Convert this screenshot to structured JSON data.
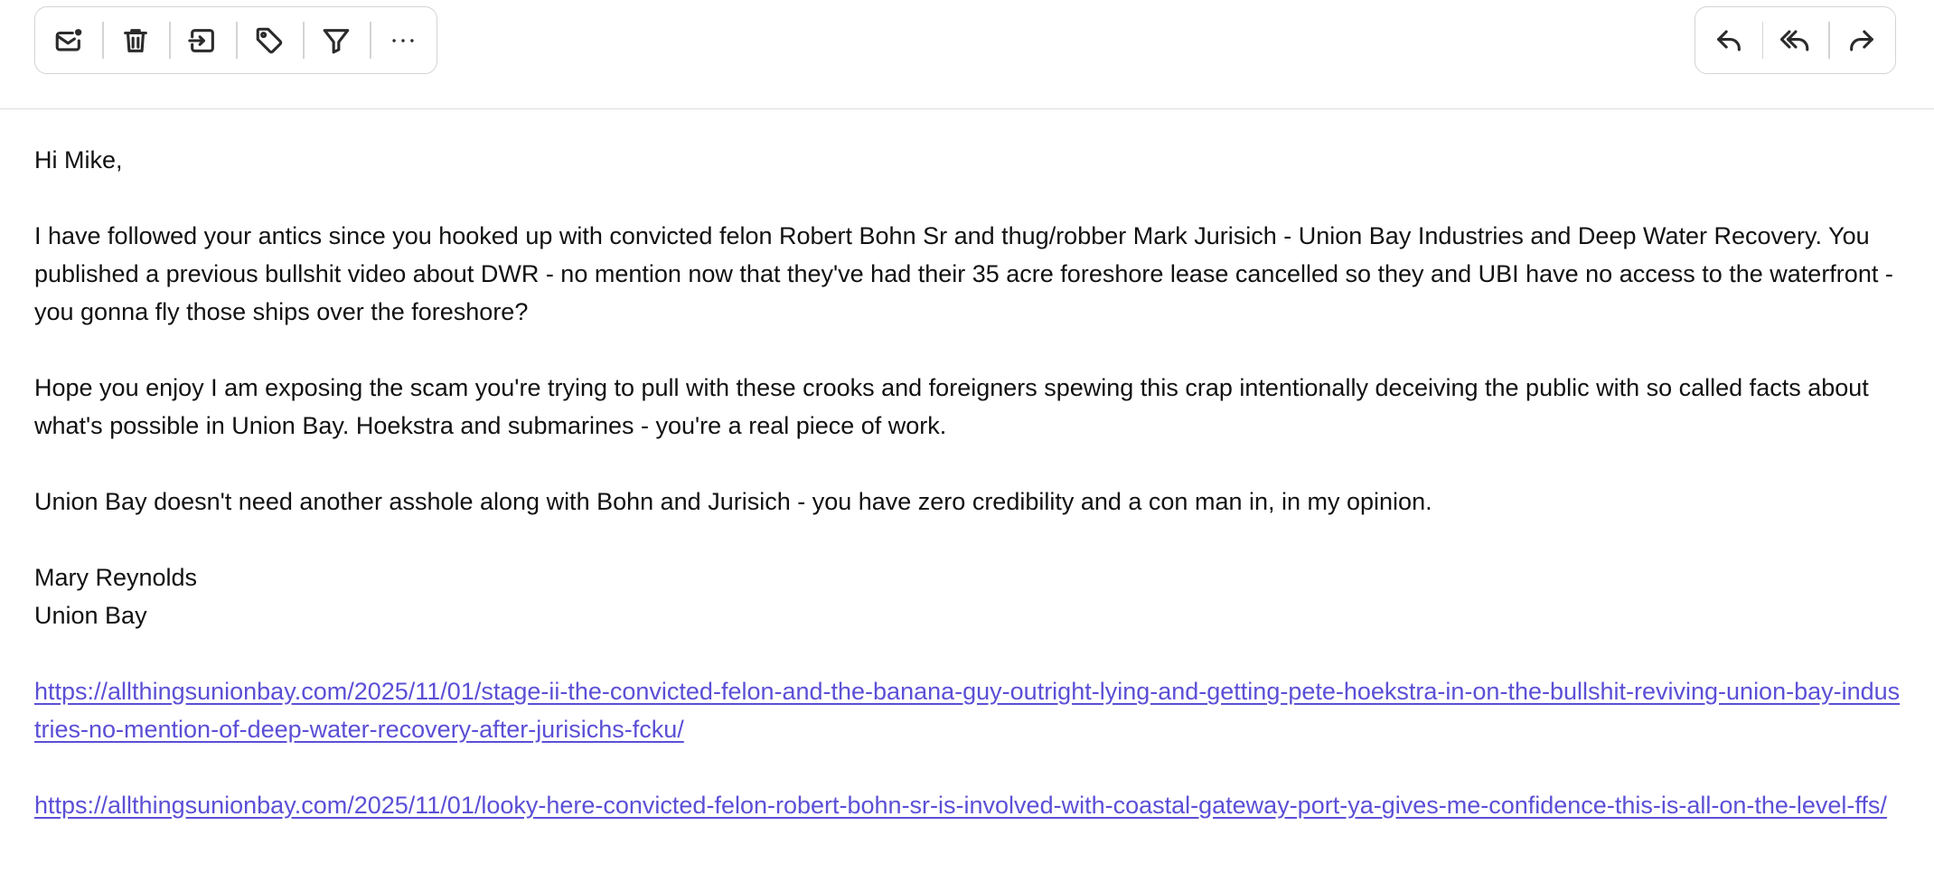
{
  "toolbar": {
    "left_buttons": [
      {
        "icon": "mark-unread-icon",
        "label": ""
      },
      {
        "icon": "trash-icon",
        "label": ""
      },
      {
        "icon": "move-to-folder-icon",
        "label": ""
      },
      {
        "icon": "tag-icon",
        "label": ""
      },
      {
        "icon": "filter-icon",
        "label": ""
      },
      {
        "icon": "more-icon",
        "label": ""
      }
    ],
    "right_buttons": [
      {
        "icon": "reply-icon",
        "label": ""
      },
      {
        "icon": "reply-all-icon",
        "label": ""
      },
      {
        "icon": "forward-icon",
        "label": ""
      }
    ]
  },
  "message": {
    "greeting": "Hi Mike,",
    "paragraph1": "I have followed your antics since you hooked up with convicted felon Robert Bohn Sr and thug/robber Mark Jurisich - Union Bay Industries and Deep Water Recovery. You published a previous bullshit video about DWR - no mention now that they've had their 35 acre foreshore lease cancelled so they and UBI have no access to the waterfront - you gonna fly those ships over the foreshore?",
    "paragraph2": "Hope you enjoy I am exposing the scam you're trying to pull with these crooks and foreigners spewing this crap intentionally deceiving the public with so called facts about what's possible in Union Bay.  Hoekstra and submarines - you're a real piece of work.",
    "paragraph3": "Union Bay doesn't need another asshole along with Bohn and Jurisich - you have zero credibility and a con man in, in my opinion.",
    "signature_name": "Mary Reynolds",
    "signature_location": "Union Bay",
    "link1": "https://allthingsunionbay.com/2025/11/01/stage-ii-the-convicted-felon-and-the-banana-guy-outright-lying-and-getting-pete-hoekstra-in-on-the-bullshit-reviving-union-bay-industries-no-mention-of-deep-water-recovery-after-jurisichs-fcku/",
    "link2": "https://allthingsunionbay.com/2025/11/01/looky-here-convicted-felon-robert-bohn-sr-is-involved-with-coastal-gateway-port-ya-gives-me-confidence-this-is-all-on-the-level-ffs/"
  },
  "colors": {
    "link": "#5b4fd6",
    "text": "#111111",
    "border": "#d4d4d4"
  }
}
